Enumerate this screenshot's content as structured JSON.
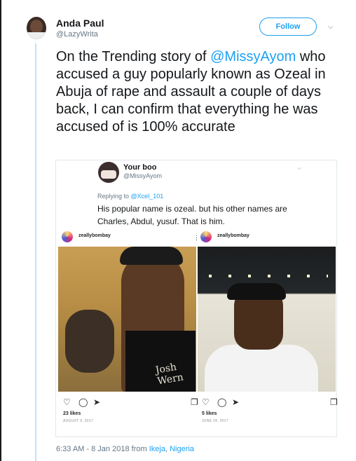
{
  "tweet": {
    "author": {
      "name": "Anda Paul",
      "handle": "@LazyWrita"
    },
    "follow_label": "Follow",
    "text_before": "On the Trending story of ",
    "mention": "@MissyAyom",
    "text_after": " who accused a guy popularly known as Ozeal in Abuja of rape and assault a couple of days back, I can confirm that everything he was accused of is 100% accurate",
    "timestamp": "6:33 AM - 8 Jan 2018",
    "from_label": "from",
    "location_city": "Ikeja",
    "location_sep": ",",
    "location_country": "Nigeria"
  },
  "quoted": {
    "name": "Your boo",
    "handle": "@MissyAyom",
    "replying_prefix": "Replying to",
    "replying_to": "@Xcel_101",
    "text": "His popular name is ozeal.  but his other names are Charles, Abdul, yusuf. That is him."
  },
  "instagram_posts": [
    {
      "username": "zeallybombay",
      "likes": "23 likes",
      "date": "AUGUST 9, 2017",
      "shirt_text": "Josh Wern"
    },
    {
      "username": "zeallybombay",
      "likes": "5 likes",
      "date": "JUNE 24, 2017"
    }
  ],
  "icons": {
    "chevron": "chevron-down-icon",
    "heart": "heart-icon",
    "comment": "comment-icon",
    "share": "share-icon",
    "bookmark": "bookmark-icon",
    "more": "more-icon"
  },
  "colors": {
    "accent": "#1da1f2",
    "text": "#14171a",
    "secondary": "#657786",
    "thread_line": "#bfe3fb"
  }
}
